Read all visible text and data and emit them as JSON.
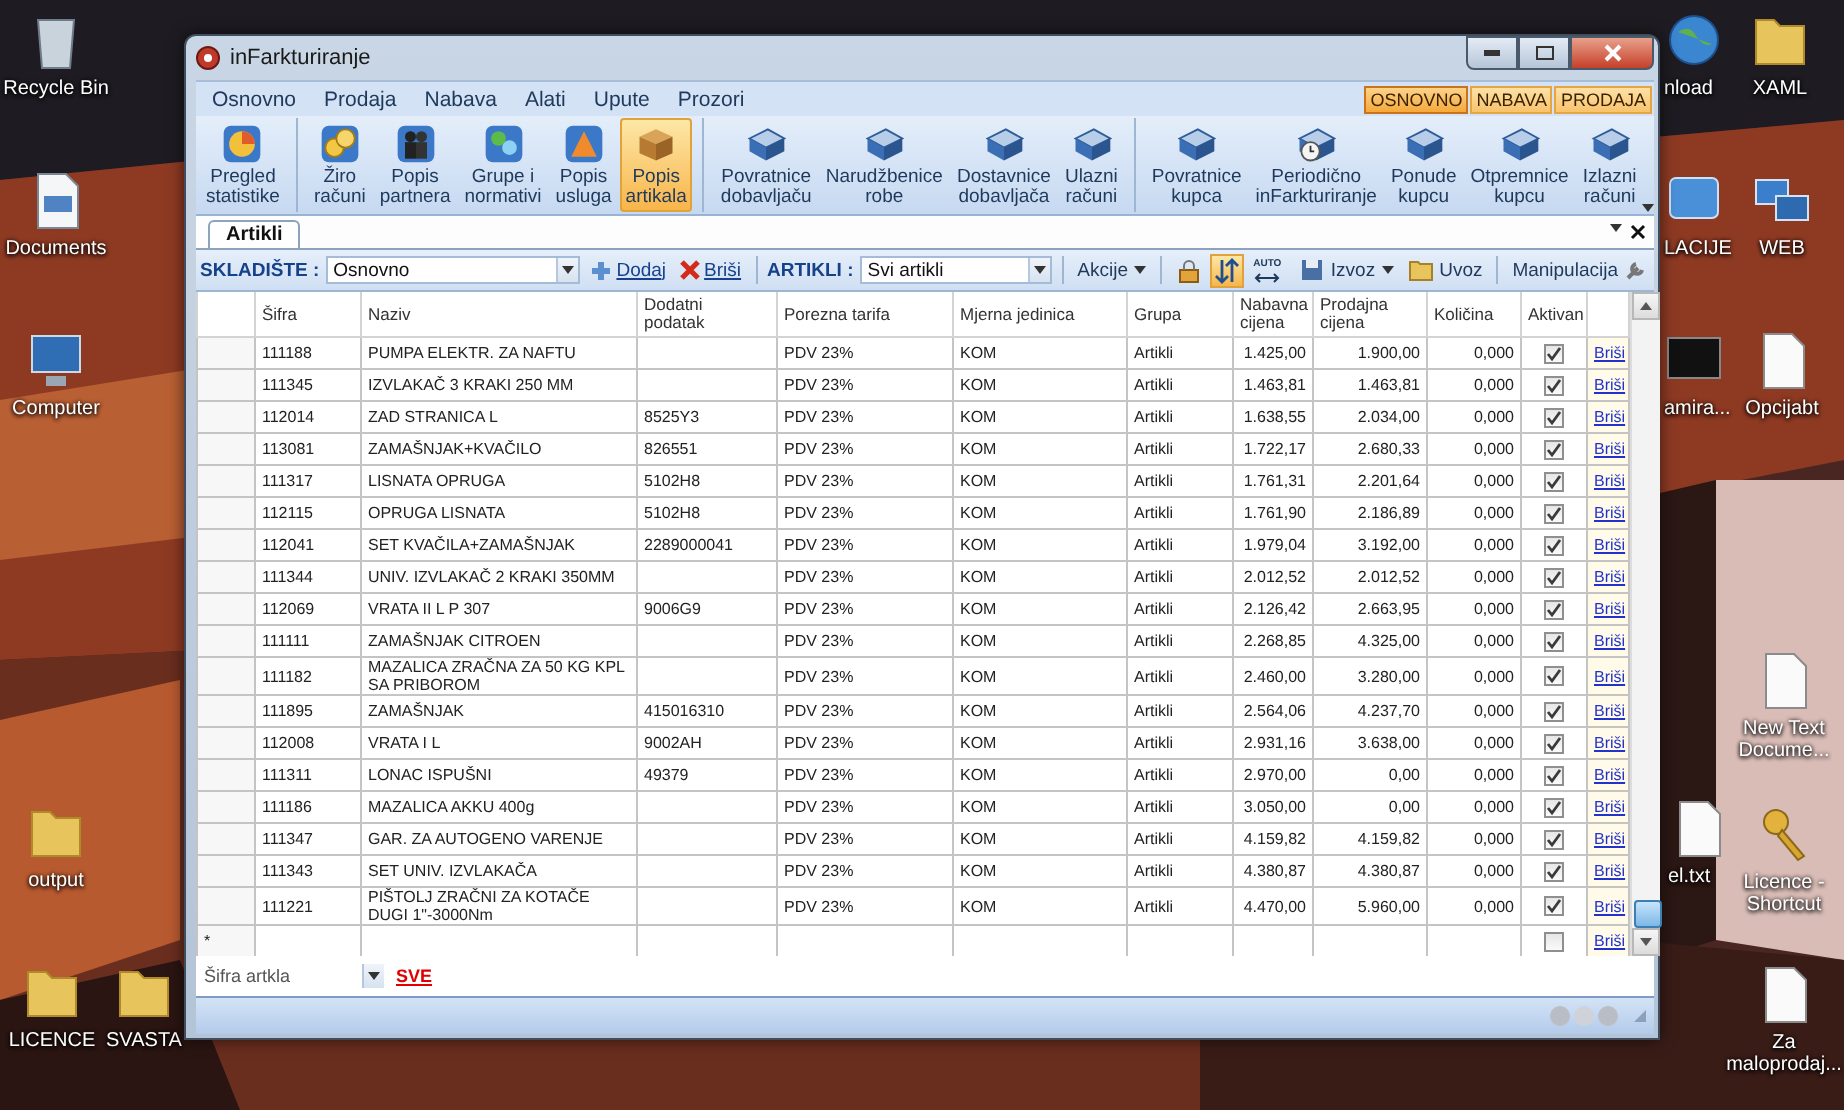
{
  "desktop": {
    "icons": [
      {
        "label": "Recycle Bin",
        "kind": "bin"
      },
      {
        "label": "Documents",
        "kind": "docs"
      },
      {
        "label": "Computer",
        "kind": "computer"
      },
      {
        "label": "output",
        "kind": "folder"
      },
      {
        "label": "LICENCE",
        "kind": "folder"
      },
      {
        "label": "SVASTA",
        "kind": "folder"
      },
      {
        "label": "nload",
        "kind": "globe"
      },
      {
        "label": "XAML",
        "kind": "folder"
      },
      {
        "label": "LACIJE",
        "kind": "tile"
      },
      {
        "label": "WEB",
        "kind": "network"
      },
      {
        "label": "amira...",
        "kind": "console"
      },
      {
        "label": "Opcijabt",
        "kind": "document"
      },
      {
        "label": "el.txt",
        "kind": "document"
      },
      {
        "label": "New Text Docume...",
        "kind": "document"
      },
      {
        "label": "Licence - Shortcut",
        "kind": "keys"
      },
      {
        "label": "Za maloprodaj...",
        "kind": "document"
      }
    ]
  },
  "window": {
    "title": "inFarkturiranje",
    "menu": [
      "Osnovno",
      "Prodaja",
      "Nabava",
      "Alati",
      "Upute",
      "Prozori"
    ],
    "view_switch": [
      {
        "label": "OSNOVNO",
        "selected": true
      },
      {
        "label": "NABAVA",
        "selected": false
      },
      {
        "label": "PRODAJA",
        "selected": false
      }
    ],
    "ribbon": {
      "groups": [
        {
          "items": [
            {
              "label": "Pregled\nstatistike",
              "kind": "chart",
              "selected": false
            }
          ]
        },
        {
          "items": [
            {
              "label": "Žiro\nračuni",
              "kind": "coins",
              "selected": false
            },
            {
              "label": "Popis\npartnera",
              "kind": "people",
              "selected": false
            },
            {
              "label": "Grupe i\nnormativi",
              "kind": "groups",
              "selected": false
            },
            {
              "label": "Popis\nusluga",
              "kind": "services",
              "selected": false
            },
            {
              "label": "Popis\nartikala",
              "kind": "box",
              "selected": true
            }
          ]
        },
        {
          "items": [
            {
              "label": "Povratnice\ndobavljaču",
              "kind": "tray",
              "selected": false
            },
            {
              "label": "Narudžbenice\nrobe",
              "kind": "tray",
              "selected": false
            },
            {
              "label": "Dostavnice\ndobavljača",
              "kind": "tray",
              "selected": false
            },
            {
              "label": "Ulazni\nračuni",
              "kind": "tray",
              "selected": false
            }
          ]
        },
        {
          "items": [
            {
              "label": "Povratnice\nkupca",
              "kind": "tray",
              "selected": false
            },
            {
              "label": "Periodično\ninFarkturiranje",
              "kind": "tray-clock",
              "selected": false
            },
            {
              "label": "Ponude\nkupcu",
              "kind": "tray",
              "selected": false
            },
            {
              "label": "Otpremnice\nkupcu",
              "kind": "tray",
              "selected": false
            },
            {
              "label": "Izlazni\nračuni",
              "kind": "tray",
              "selected": false
            }
          ]
        }
      ]
    },
    "doc_tabs": [
      {
        "label": "Artikli",
        "selected": true
      }
    ],
    "toolbar": {
      "warehouse_label": "SKLADIŠTE :",
      "warehouse": "Osnovno",
      "add": "Dodaj",
      "delete": "Briši",
      "articles_label": "ARTIKLI :",
      "articles": "Svi artikli",
      "actions": "Akcije",
      "toggles": [
        {
          "kind": "lock",
          "selected": false
        },
        {
          "kind": "sort",
          "selected": true
        },
        {
          "kind": "auto",
          "label": "AUTO",
          "selected": false
        }
      ],
      "export": "Izvoz",
      "import": "Uvoz",
      "manipulation": "Manipulacija"
    },
    "table": {
      "columns": [
        "Šifra",
        "Naziv",
        "Dodatni\npodatak",
        "Porezna tarifa",
        "Mjerna jedinica",
        "Grupa",
        "Nabavna\ncijena",
        "Prodajna\ncijena",
        "Količina",
        "Aktivan"
      ],
      "rows": [
        {
          "code": "111188",
          "name": "PUMPA ELEKTR. ZA NAFTU",
          "tax": "PDV 23%",
          "unit": "KOM",
          "group": "Artikli",
          "cost": "1.425,00",
          "price": "1.900,00",
          "qty": "0,000",
          "active": true,
          "action": "Briši"
        },
        {
          "code": "111345",
          "name": "IZVLAKAČ 3 KRAKI 250 MM",
          "tax": "PDV 23%",
          "unit": "KOM",
          "group": "Artikli",
          "cost": "1.463,81",
          "price": "1.463,81",
          "qty": "0,000",
          "active": true,
          "action": "Briši"
        },
        {
          "code": "112014",
          "name": "ZAD STRANICA L",
          "extra": "8525Y3",
          "tax": "PDV 23%",
          "unit": "KOM",
          "group": "Artikli",
          "cost": "1.638,55",
          "price": "2.034,00",
          "qty": "0,000",
          "active": true,
          "action": "Briši"
        },
        {
          "code": "113081",
          "name": "ZAMAŠNJAK+KVAČILO",
          "extra": "826551",
          "tax": "PDV 23%",
          "unit": "KOM",
          "group": "Artikli",
          "cost": "1.722,17",
          "price": "2.680,33",
          "qty": "0,000",
          "active": true,
          "action": "Briši"
        },
        {
          "code": "111317",
          "name": "LISNATA OPRUGA",
          "extra": "5102H8",
          "tax": "PDV 23%",
          "unit": "KOM",
          "group": "Artikli",
          "cost": "1.761,31",
          "price": "2.201,64",
          "qty": "0,000",
          "active": true,
          "action": "Briši"
        },
        {
          "code": "112115",
          "name": "OPRUGA LISNATA",
          "extra": "5102H8",
          "tax": "PDV 23%",
          "unit": "KOM",
          "group": "Artikli",
          "cost": "1.761,90",
          "price": "2.186,89",
          "qty": "0,000",
          "active": true,
          "action": "Briši"
        },
        {
          "code": "112041",
          "name": "SET KVAČILA+ZAMAŠNJAK",
          "extra": "2289000041",
          "tax": "PDV 23%",
          "unit": "KOM",
          "group": "Artikli",
          "cost": "1.979,04",
          "price": "3.192,00",
          "qty": "0,000",
          "active": true,
          "action": "Briši"
        },
        {
          "code": "111344",
          "name": "UNIV. IZVLAKAČ 2 KRAKI 350MM",
          "tax": "PDV 23%",
          "unit": "KOM",
          "group": "Artikli",
          "cost": "2.012,52",
          "price": "2.012,52",
          "qty": "0,000",
          "active": true,
          "action": "Briši"
        },
        {
          "code": "112069",
          "name": "VRATA II L P 307",
          "extra": "9006G9",
          "tax": "PDV 23%",
          "unit": "KOM",
          "group": "Artikli",
          "cost": "2.126,42",
          "price": "2.663,95",
          "qty": "0,000",
          "active": true,
          "action": "Briši"
        },
        {
          "code": "111111",
          "name": "ZAMAŠNJAK CITROEN",
          "tax": "PDV 23%",
          "unit": "KOM",
          "group": "Artikli",
          "cost": "2.268,85",
          "price": "4.325,00",
          "qty": "0,000",
          "active": true,
          "action": "Briši"
        },
        {
          "code": "111182",
          "name": "MAZALICA ZRAČNA ZA 50 KG KPL SA PRIBOROM",
          "tax": "PDV 23%",
          "unit": "KOM",
          "group": "Artikli",
          "cost": "2.460,00",
          "price": "3.280,00",
          "qty": "0,000",
          "active": true,
          "action": "Briši"
        },
        {
          "code": "111895",
          "name": "ZAMAŠNJAK",
          "extra": "415016310",
          "tax": "PDV 23%",
          "unit": "KOM",
          "group": "Artikli",
          "cost": "2.564,06",
          "price": "4.237,70",
          "qty": "0,000",
          "active": true,
          "action": "Briši"
        },
        {
          "code": "112008",
          "name": "VRATA I L",
          "extra": "9002AH",
          "tax": "PDV 23%",
          "unit": "KOM",
          "group": "Artikli",
          "cost": "2.931,16",
          "price": "3.638,00",
          "qty": "0,000",
          "active": true,
          "action": "Briši"
        },
        {
          "code": "111311",
          "name": "LONAC ISPUŠNI",
          "extra": "49379",
          "tax": "PDV 23%",
          "unit": "KOM",
          "group": "Artikli",
          "cost": "2.970,00",
          "price": "0,00",
          "qty": "0,000",
          "active": true,
          "action": "Briši"
        },
        {
          "code": "111186",
          "name": "MAZALICA AKKU 400g",
          "tax": "PDV 23%",
          "unit": "KOM",
          "group": "Artikli",
          "cost": "3.050,00",
          "price": "0,00",
          "qty": "0,000",
          "active": true,
          "action": "Briši"
        },
        {
          "code": "111347",
          "name": "GAR. ZA AUTOGENO VARENJE",
          "tax": "PDV 23%",
          "unit": "KOM",
          "group": "Artikli",
          "cost": "4.159,82",
          "price": "4.159,82",
          "qty": "0,000",
          "active": true,
          "action": "Briši"
        },
        {
          "code": "111343",
          "name": "SET UNIV. IZVLAKAČA",
          "tax": "PDV 23%",
          "unit": "KOM",
          "group": "Artikli",
          "cost": "4.380,87",
          "price": "4.380,87",
          "qty": "0,000",
          "active": true,
          "action": "Briši"
        },
        {
          "code": "111221",
          "name": "PIŠTOLJ ZRAČNI ZA KOTAČE DUGI 1\"-3000Nm",
          "tax": "PDV 23%",
          "unit": "KOM",
          "group": "Artikli",
          "cost": "4.470,00",
          "price": "5.960,00",
          "qty": "0,000",
          "active": true,
          "action": "Briši"
        }
      ],
      "new_row": {
        "marker": "*",
        "active": false,
        "action": "Briši"
      }
    },
    "footer": {
      "filter": "Šifra artkla",
      "show_all": "SVE"
    }
  }
}
